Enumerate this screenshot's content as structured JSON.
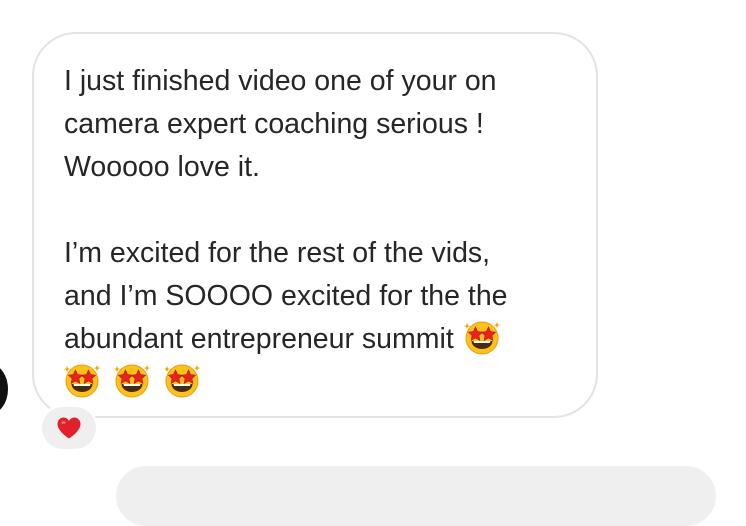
{
  "message": {
    "paragraph_1": [
      "I just finished video one of your on",
      "camera expert coaching serious !",
      "Wooooo love it."
    ],
    "paragraph_2": [
      "I’m excited for the rest of the vids,",
      "and I’m SOOOO excited for the the",
      "abundant entrepreneur summit"
    ],
    "emojis": [
      "star-struck",
      "star-struck",
      "star-struck",
      "star-struck"
    ]
  },
  "reaction": {
    "emoji": "red-heart"
  },
  "colors": {
    "bubble_border": "#e3e3e3",
    "text": "#262626",
    "reaction_bg": "#efefef",
    "heart": "#e0202a",
    "emoji_face": "#fcc21b",
    "emoji_star": "#f4a000",
    "next_bubble": "#efefef"
  }
}
